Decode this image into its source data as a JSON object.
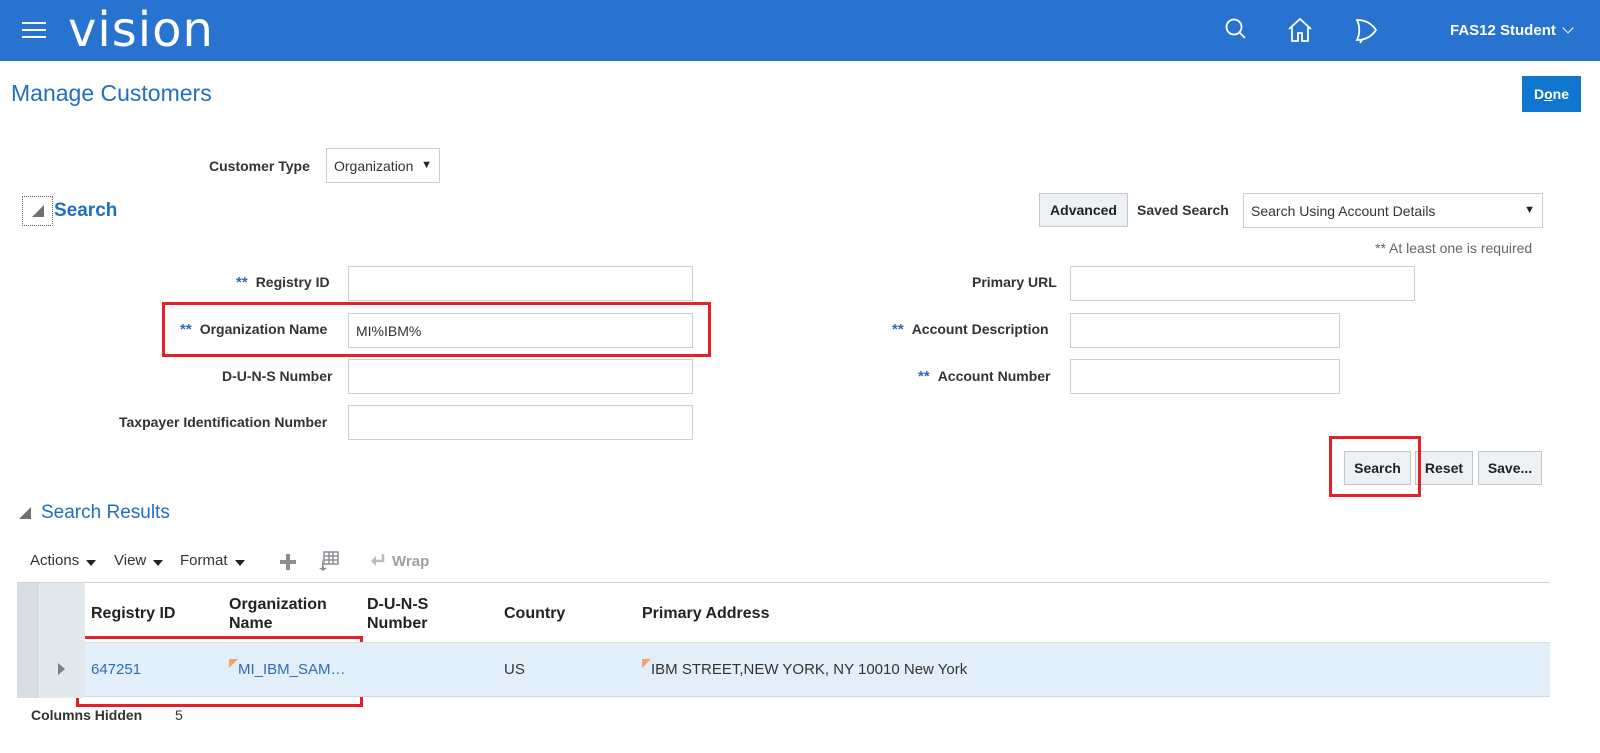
{
  "header": {
    "logo": "vision",
    "user_name": "FAS12 Student"
  },
  "page": {
    "title": "Manage Customers",
    "done_label_pre": "D",
    "done_label_u": "o",
    "done_label_post": "ne"
  },
  "customer_type": {
    "label": "Customer Type",
    "value": "Organization"
  },
  "search": {
    "section_title": "Search",
    "advanced_label": "Advanced",
    "saved_search_label": "Saved Search",
    "saved_search_value": "Search Using Account Details",
    "required_hint": "** At least one is required",
    "required_marker": "**",
    "fields": {
      "registry_id": {
        "label": "Registry ID",
        "value": ""
      },
      "organization_name": {
        "label": "Organization Name",
        "value": "MI%IBM%"
      },
      "duns_number": {
        "label": "D-U-N-S Number",
        "value": ""
      },
      "taxpayer_id": {
        "label": "Taxpayer Identification Number",
        "value": ""
      },
      "primary_url": {
        "label": "Primary URL",
        "value": ""
      },
      "account_description": {
        "label": "Account Description",
        "value": ""
      },
      "account_number": {
        "label": "Account Number",
        "value": ""
      }
    },
    "buttons": {
      "search": "Search",
      "reset": "Reset",
      "save": "Save..."
    }
  },
  "results": {
    "section_title": "Search Results",
    "toolbar": {
      "actions": "Actions",
      "view": "View",
      "format": "Format",
      "wrap": "Wrap"
    },
    "columns": {
      "registry_id": "Registry ID",
      "organization_name_1": "Organization",
      "organization_name_2": "Name",
      "duns_1": "D-U-N-S",
      "duns_2": "Number",
      "country": "Country",
      "primary_address": "Primary Address"
    },
    "rows": [
      {
        "registry_id": "647251",
        "organization_name": "MI_IBM_SAM…",
        "duns": "",
        "country": "US",
        "primary_address": "IBM STREET,NEW YORK, NY 10010 New York"
      }
    ],
    "footer": {
      "columns_hidden_label": "Columns Hidden",
      "columns_hidden_value": "5"
    }
  },
  "colors": {
    "header_bg": "#2873d0",
    "accent": "#1f6fc0",
    "highlight_box": "#e0232b",
    "selected_row": "#e2eefa"
  }
}
